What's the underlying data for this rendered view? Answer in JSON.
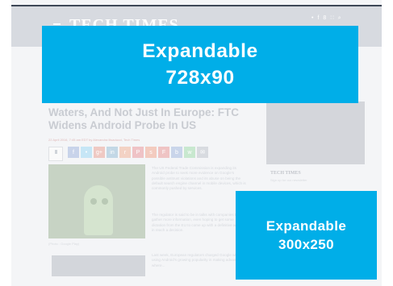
{
  "header": {
    "logo": "TECH TIMES",
    "social_icons": [
      "twitter-icon",
      "facebook-icon",
      "googleplus-icon",
      "rss-icon",
      "search-icon"
    ],
    "social_glyphs": [
      "•",
      "f",
      "8",
      "∷",
      "⌕"
    ]
  },
  "article": {
    "headline": "Waters, And Not Just In Europe: FTC Widens Android Probe In US",
    "byline": "22 April 2016, 7:45 am EDT  by Alexandra Ilisaducci, Tech Times",
    "share_count": "1",
    "share_buttons": [
      {
        "name": "facebook",
        "glyph": "f",
        "color": "#c8d3ea"
      },
      {
        "name": "twitter",
        "glyph": "•",
        "color": "#c6e6f6"
      },
      {
        "name": "googleplus",
        "glyph": "g+",
        "color": "#efc9c3"
      },
      {
        "name": "linkedin",
        "glyph": "in",
        "color": "#c3d8e6"
      },
      {
        "name": "reddit",
        "glyph": "r",
        "color": "#f3d2c4"
      },
      {
        "name": "pinterest",
        "glyph": "P",
        "color": "#efc3c6"
      },
      {
        "name": "stumbleupon",
        "glyph": "s",
        "color": "#f3cbbf"
      },
      {
        "name": "flipboard",
        "glyph": "F",
        "color": "#efc4c4"
      },
      {
        "name": "bookmark",
        "glyph": "b",
        "color": "#c9d5ea"
      },
      {
        "name": "whatsapp",
        "glyph": "w",
        "color": "#c8e8cf"
      },
      {
        "name": "email",
        "glyph": "✉",
        "color": "#d8dbe0"
      }
    ],
    "image_caption": "(Photo : Google Play)",
    "paragraphs": [
      "The US Federal Trade Commission is expanding its Android probe to seek more evidence on Google's possible antitrust violations and its abuse on being the default search engine channel in mobile devices, which is commonly pushed by services.",
      "The regulator is said to be in talks with companies to gather more information, even hoping to get some dictation from the EU to come up with a definitive answer in reach a decision.",
      "Last week, European regulators charged Google with using Android's growing popularity in making advances where..."
    ],
    "link_text": "charged"
  },
  "sidebar": {
    "brand": "TECH TIMES",
    "text": "Sign up for our newsletter"
  },
  "ads": {
    "top": {
      "title": "Expandable",
      "size": "728x90"
    },
    "side": {
      "title": "Expandable",
      "size": "300x250"
    },
    "color": "#00aee8"
  }
}
